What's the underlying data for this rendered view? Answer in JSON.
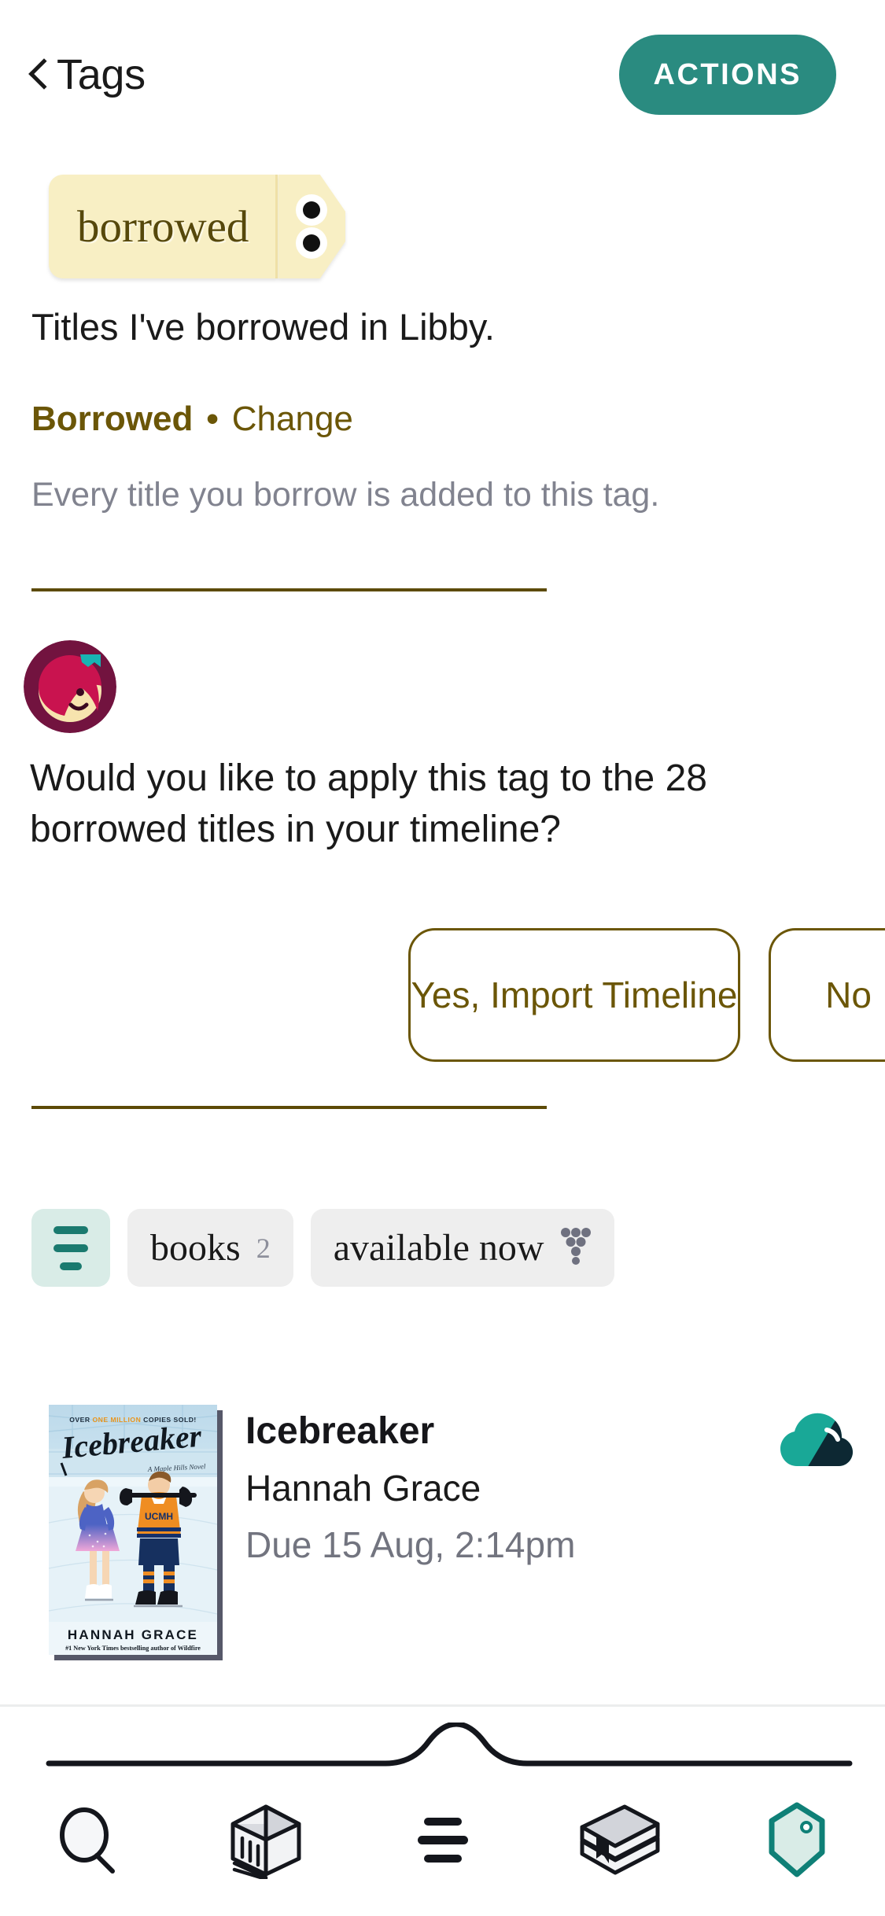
{
  "header": {
    "back_label": "Tags",
    "back_icon": "chevron-left-icon",
    "actions_label": "ACTIONS"
  },
  "tag": {
    "name": "borrowed",
    "menu_icon": "kebab-menu-icon",
    "description": "Titles I've borrowed in Libby.",
    "meta_type": "Borrowed",
    "meta_separator": "•",
    "meta_change_label": "Change",
    "meta_note": "Every title you borrow is added to this tag."
  },
  "prompt": {
    "avatar_icon": "libby-avatar-icon",
    "question": "Would you like to apply this tag to the 28 borrowed titles in your timeline?",
    "yes_label": "Yes, Import Timeline",
    "no_label": "No"
  },
  "filters": {
    "filter_icon": "filter-lines-icon",
    "chips": [
      {
        "label": "books",
        "count": "2",
        "icon": null
      },
      {
        "label": "available now",
        "count": null,
        "icon": "availability-funnel-icon"
      }
    ]
  },
  "books": [
    {
      "title": "Icebreaker",
      "author": "Hannah Grace",
      "due": "Due 15 Aug, 2:14pm",
      "status_icon": "cloud-partially-downloaded-icon",
      "cover": {
        "banner": "OVER ONE MILLION COPIES SOLD!",
        "title": "Icebreaker",
        "series": "A Maple Hills Novel",
        "jersey": "UCMH",
        "author": "HANNAH GRACE",
        "tagline": "#1 New York Times bestselling author of Wildfire"
      }
    }
  ],
  "bottom_nav": [
    {
      "name": "search-icon",
      "label": "Search",
      "active": false
    },
    {
      "name": "library-icon",
      "label": "Library",
      "active": false
    },
    {
      "name": "menu-icon",
      "label": "Menu",
      "active": false
    },
    {
      "name": "shelf-icon",
      "label": "Shelf",
      "active": false
    },
    {
      "name": "tags-icon",
      "label": "Tags",
      "active": true
    }
  ],
  "colors": {
    "accent_teal": "#2a8b80",
    "tag_yellow": "#f8efc4",
    "tag_text": "#56480b",
    "olive": "#6b5607",
    "muted": "#81838f",
    "chip_bg": "#eeeeee",
    "chip_active_bg": "#d9ece7"
  }
}
